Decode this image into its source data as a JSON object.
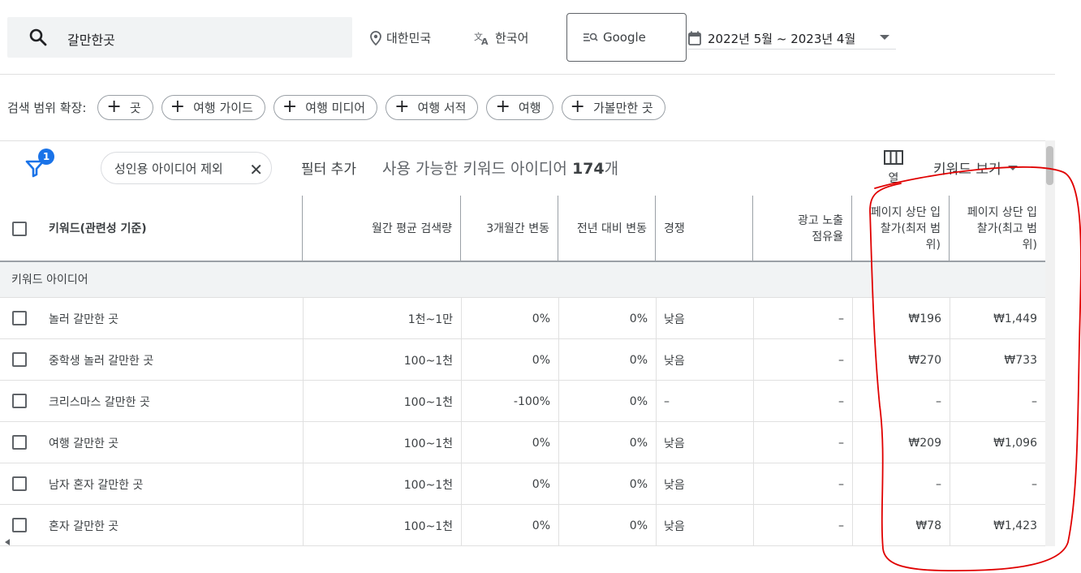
{
  "search": {
    "query": "갈만한곳"
  },
  "location": {
    "country": "대한민국",
    "language": "한국어",
    "engine": "Google"
  },
  "date_range": "2022년 5월 ~ 2023년 4월",
  "expand": {
    "label": "검색 범위 확장:",
    "chips": [
      "곳",
      "여행 가이드",
      "여행 미디어",
      "여행 서적",
      "여행",
      "가볼만한 곳"
    ]
  },
  "filters": {
    "badge": "1",
    "active_chip": "성인용 아이디어 제외",
    "add_filter": "필터 추가",
    "count_prefix": "사용 가능한 키워드 아이디어",
    "count_num": "174",
    "count_suffix": "개",
    "columns_label": "열",
    "view_label": "키워드 보기"
  },
  "table": {
    "headers": {
      "keyword": "키워드(관련성 기준)",
      "monthly": "월간 평균 검색량",
      "three_month": "3개월간 변동",
      "yoy": "전년 대비 변동",
      "competition": "경쟁",
      "impression": "광고 노출 점유율",
      "bid_low": "페이지 상단 입찰가(최저 범위)",
      "bid_high": "페이지 상단 입찰가(최고 범위)"
    },
    "group_label": "키워드 아이디어",
    "rows": [
      {
        "keyword": "놀러 갈만한 곳",
        "monthly": "1천~1만",
        "three_month": "0%",
        "yoy": "0%",
        "competition": "낮음",
        "impression": "–",
        "bid_low": "₩196",
        "bid_high": "₩1,449"
      },
      {
        "keyword": "중학생 놀러 갈만한 곳",
        "monthly": "100~1천",
        "three_month": "0%",
        "yoy": "0%",
        "competition": "낮음",
        "impression": "–",
        "bid_low": "₩270",
        "bid_high": "₩733"
      },
      {
        "keyword": "크리스마스 갈만한 곳",
        "monthly": "100~1천",
        "three_month": "-100%",
        "yoy": "0%",
        "competition": "–",
        "impression": "–",
        "bid_low": "–",
        "bid_high": "–"
      },
      {
        "keyword": "여행 갈만한 곳",
        "monthly": "100~1천",
        "three_month": "0%",
        "yoy": "0%",
        "competition": "낮음",
        "impression": "–",
        "bid_low": "₩209",
        "bid_high": "₩1,096"
      },
      {
        "keyword": "남자 혼자 갈만한 곳",
        "monthly": "100~1천",
        "three_month": "0%",
        "yoy": "0%",
        "competition": "낮음",
        "impression": "–",
        "bid_low": "–",
        "bid_high": "–"
      },
      {
        "keyword": "혼자 갈만한 곳",
        "monthly": "100~1천",
        "three_month": "0%",
        "yoy": "0%",
        "competition": "낮음",
        "impression": "–",
        "bid_low": "₩78",
        "bid_high": "₩1,423"
      }
    ]
  },
  "colors": {
    "accent": "#1a73e8",
    "annotation": "#e00000"
  }
}
